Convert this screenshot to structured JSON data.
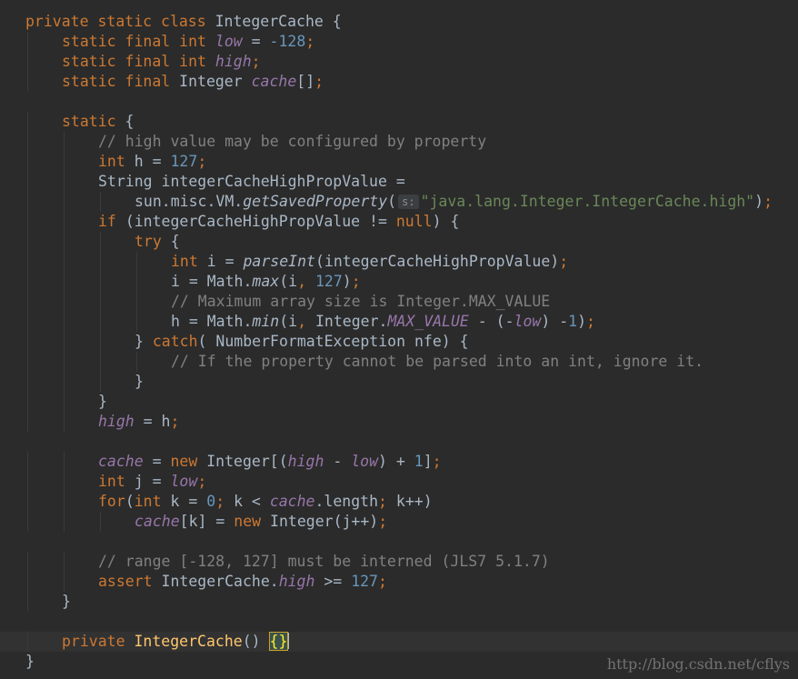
{
  "editor": {
    "background": "#2b2b2b",
    "current_line_background": "#323232",
    "colors": {
      "keyword": "#cc7832",
      "number": "#6897bb",
      "string": "#6a8759",
      "comment": "#808080",
      "field": "#9876aa",
      "method_declaration": "#ffc66d",
      "default_text": "#a9b7c6"
    },
    "lines": [
      [
        {
          "t": "private static class ",
          "c": "kw"
        },
        {
          "t": "IntegerCache {"
        }
      ],
      [
        {
          "t": "static final int ",
          "c": "kw"
        },
        {
          "t": "low",
          "c": "fld"
        },
        {
          "t": " = "
        },
        {
          "t": "-128",
          "c": "num"
        },
        {
          "t": ";",
          "c": "kw"
        }
      ],
      [
        {
          "t": "static final int ",
          "c": "kw"
        },
        {
          "t": "high",
          "c": "fld"
        },
        {
          "t": ";",
          "c": "kw"
        }
      ],
      [
        {
          "t": "static final ",
          "c": "kw"
        },
        {
          "t": "Integer "
        },
        {
          "t": "cache",
          "c": "fld"
        },
        {
          "t": "[]"
        },
        {
          "t": ";",
          "c": "kw"
        }
      ],
      [],
      [
        {
          "t": "static ",
          "c": "kw"
        },
        {
          "t": "{"
        }
      ],
      [
        {
          "t": "// high value may be configured by property",
          "c": "cmt"
        }
      ],
      [
        {
          "t": "int ",
          "c": "kw"
        },
        {
          "t": "h = "
        },
        {
          "t": "127",
          "c": "num"
        },
        {
          "t": ";",
          "c": "kw"
        }
      ],
      [
        {
          "t": "String integerCacheHighPropValue ="
        }
      ],
      [
        {
          "t": "sun.misc.VM."
        },
        {
          "t": "getSavedProperty",
          "c": "ita"
        },
        {
          "t": "("
        },
        {
          "t": "s:",
          "c": "hint"
        },
        {
          "t": "\"java.lang.Integer.IntegerCache.high\"",
          "c": "str"
        },
        {
          "t": ")"
        },
        {
          "t": ";",
          "c": "kw"
        }
      ],
      [
        {
          "t": "if ",
          "c": "kw"
        },
        {
          "t": "(integerCacheHighPropValue != "
        },
        {
          "t": "null",
          "c": "kw"
        },
        {
          "t": ") {"
        }
      ],
      [
        {
          "t": "try ",
          "c": "kw"
        },
        {
          "t": "{"
        }
      ],
      [
        {
          "t": "int ",
          "c": "kw"
        },
        {
          "t": "i = "
        },
        {
          "t": "parseInt",
          "c": "ita"
        },
        {
          "t": "(integerCacheHighPropValue)"
        },
        {
          "t": ";",
          "c": "kw"
        }
      ],
      [
        {
          "t": "i = Math."
        },
        {
          "t": "max",
          "c": "ita"
        },
        {
          "t": "(i"
        },
        {
          "t": ", ",
          "c": "kw"
        },
        {
          "t": "127",
          "c": "num"
        },
        {
          "t": ")"
        },
        {
          "t": ";",
          "c": "kw"
        }
      ],
      [
        {
          "t": "// Maximum array size is Integer.MAX_VALUE",
          "c": "cmt"
        }
      ],
      [
        {
          "t": "h = Math."
        },
        {
          "t": "min",
          "c": "ita"
        },
        {
          "t": "(i"
        },
        {
          "t": ", ",
          "c": "kw"
        },
        {
          "t": "Integer."
        },
        {
          "t": "MAX_VALUE",
          "c": "fld"
        },
        {
          "t": " - (-"
        },
        {
          "t": "low",
          "c": "fld"
        },
        {
          "t": ") -"
        },
        {
          "t": "1",
          "c": "num"
        },
        {
          "t": ")"
        },
        {
          "t": ";",
          "c": "kw"
        }
      ],
      [
        {
          "t": "} "
        },
        {
          "t": "catch",
          "c": "kw"
        },
        {
          "t": "( NumberFormatException nfe) {"
        }
      ],
      [
        {
          "t": "// If the property cannot be parsed into an int, ignore it.",
          "c": "cmt"
        }
      ],
      [
        {
          "t": "}"
        }
      ],
      [
        {
          "t": "}"
        }
      ],
      [
        {
          "t": "high",
          "c": "fld"
        },
        {
          "t": " = h"
        },
        {
          "t": ";",
          "c": "kw"
        }
      ],
      [],
      [
        {
          "t": "cache",
          "c": "fld"
        },
        {
          "t": " = "
        },
        {
          "t": "new ",
          "c": "kw"
        },
        {
          "t": "Integer[("
        },
        {
          "t": "high",
          "c": "fld"
        },
        {
          "t": " - "
        },
        {
          "t": "low",
          "c": "fld"
        },
        {
          "t": ") + "
        },
        {
          "t": "1",
          "c": "num"
        },
        {
          "t": "]"
        },
        {
          "t": ";",
          "c": "kw"
        }
      ],
      [
        {
          "t": "int ",
          "c": "kw"
        },
        {
          "t": "j = "
        },
        {
          "t": "low",
          "c": "fld"
        },
        {
          "t": ";",
          "c": "kw"
        }
      ],
      [
        {
          "t": "for",
          "c": "kw"
        },
        {
          "t": "("
        },
        {
          "t": "int ",
          "c": "kw"
        },
        {
          "t": "k = "
        },
        {
          "t": "0",
          "c": "num"
        },
        {
          "t": "; ",
          "c": "kw"
        },
        {
          "t": "k < "
        },
        {
          "t": "cache",
          "c": "fld"
        },
        {
          "t": ".length"
        },
        {
          "t": "; ",
          "c": "kw"
        },
        {
          "t": "k++)"
        }
      ],
      [
        {
          "t": "cache",
          "c": "fld"
        },
        {
          "t": "[k] = "
        },
        {
          "t": "new ",
          "c": "kw"
        },
        {
          "t": "Integer(j++)"
        },
        {
          "t": ";",
          "c": "kw"
        }
      ],
      [],
      [
        {
          "t": "// range [-128, 127] must be interned (JLS7 5.1.7)",
          "c": "cmt"
        }
      ],
      [
        {
          "t": "assert ",
          "c": "kw"
        },
        {
          "t": "IntegerCache."
        },
        {
          "t": "high",
          "c": "fld"
        },
        {
          "t": " >= "
        },
        {
          "t": "127",
          "c": "num"
        },
        {
          "t": ";",
          "c": "kw"
        }
      ],
      [
        {
          "t": "}"
        }
      ],
      [],
      [
        {
          "t": "private ",
          "c": "kw"
        },
        {
          "t": "IntegerCache",
          "c": "cls"
        },
        {
          "t": "() "
        },
        {
          "t": "{}",
          "c": "brace-match"
        },
        {
          "t": "",
          "c": "caret"
        }
      ],
      [
        {
          "t": "}"
        }
      ]
    ]
  },
  "watermark": "http://blog.csdn.net/cflys"
}
